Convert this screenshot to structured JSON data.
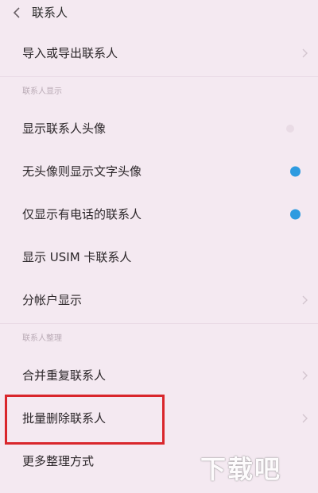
{
  "header": {
    "title": "联系人",
    "back_icon": "chevron-left-icon"
  },
  "items": {
    "import_export": "导入或导出联系人",
    "display_section": "联系人显示",
    "show_avatar": "显示联系人头像",
    "text_avatar": "无头像则显示文字头像",
    "only_phone": "仅显示有电话的联系人",
    "show_usim": "显示 USIM 卡联系人",
    "account_display": "分帐户显示",
    "organize_section": "联系人整理",
    "merge_duplicates": "合并重复联系人",
    "batch_delete": "批量删除联系人",
    "more_organize": "更多整理方式"
  },
  "toggles": {
    "show_avatar": false,
    "text_avatar": true,
    "only_phone": true
  },
  "colors": {
    "background": "#f4e9f1",
    "toggle_on": "#2e9be0",
    "highlight_border": "#d9262c"
  },
  "watermark": {
    "text": "下载吧"
  }
}
